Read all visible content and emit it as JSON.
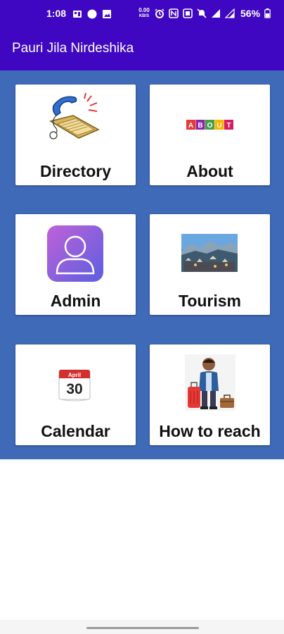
{
  "status_bar": {
    "time": "1:08",
    "net_speed_value": "0.00",
    "net_speed_unit": "KB/S",
    "battery": "56%"
  },
  "app_bar": {
    "title": "Pauri Jila Nirdeshika"
  },
  "colors": {
    "status_bar": "#3f07c2",
    "app_bar": "#3f07c2",
    "grid_background": "#3f6ab8",
    "card": "#ffffff",
    "label": "#111111"
  },
  "menu": {
    "directory": {
      "label": "Directory",
      "icon": "phone-book-icon"
    },
    "about": {
      "label": "About",
      "icon": "about-blocks-icon",
      "blocks": [
        "A",
        "B",
        "O",
        "U",
        "T"
      ]
    },
    "admin": {
      "label": "Admin",
      "icon": "user-profile-icon"
    },
    "tourism": {
      "label": "Tourism",
      "icon": "landscape-photo-icon"
    },
    "calendar": {
      "label": "Calendar",
      "icon": "calendar-icon",
      "month": "April",
      "day": "30"
    },
    "how_to_reach": {
      "label": "How to reach",
      "icon": "traveler-icon"
    }
  }
}
